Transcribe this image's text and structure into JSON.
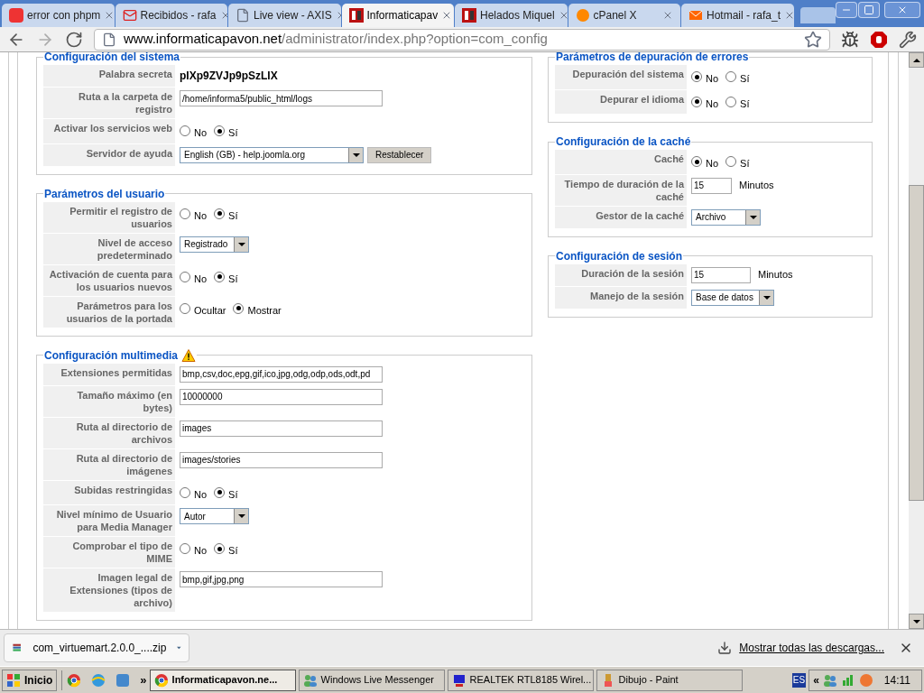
{
  "tabs": [
    {
      "label": "error con phpm",
      "selected": false
    },
    {
      "label": "Recibidos - rafa",
      "selected": false
    },
    {
      "label": "Live view - AXIS",
      "selected": false
    },
    {
      "label": "Informaticapav",
      "selected": true
    },
    {
      "label": "Helados Miquel",
      "selected": false
    },
    {
      "label": "cPanel X",
      "selected": false
    },
    {
      "label": "Hotmail - rafa_t",
      "selected": false
    }
  ],
  "address": {
    "host": "www.informaticapavon.net",
    "path": "/administrator/index.php?option=com_config"
  },
  "left_sections": [
    {
      "title": "Configuración del sistema",
      "warning": false,
      "rows": [
        {
          "label": "Palabra secreta",
          "kind": "text",
          "value": "pIXp9ZVJp9pSzLIX"
        },
        {
          "label": "Ruta a la carpeta de registro",
          "kind": "input",
          "value": "/home/informa5/public_html/logs"
        },
        {
          "label": "Activar los servicios web",
          "kind": "radio",
          "options": [
            {
              "label": "No",
              "selected": false
            },
            {
              "label": "Sí",
              "selected": true
            }
          ]
        },
        {
          "label": "Servidor de ayuda",
          "kind": "select",
          "value": "English (GB) - help.joomla.org",
          "button": "Restablecer"
        }
      ]
    },
    {
      "title": "Parámetros del usuario",
      "warning": false,
      "rows": [
        {
          "label": "Permitir el registro de usuarios",
          "kind": "radio",
          "options": [
            {
              "label": "No",
              "selected": false
            },
            {
              "label": "Sí",
              "selected": true
            }
          ]
        },
        {
          "label": "Nivel de acceso predeterminado",
          "kind": "select",
          "value": "Registrado"
        },
        {
          "label": "Activación de cuenta para los usuarios nuevos",
          "kind": "radio",
          "options": [
            {
              "label": "No",
              "selected": false
            },
            {
              "label": "Sí",
              "selected": true
            }
          ]
        },
        {
          "label": "Parámetros para los usuarios de la portada",
          "kind": "radio",
          "options": [
            {
              "label": "Ocultar",
              "selected": false
            },
            {
              "label": "Mostrar",
              "selected": true
            }
          ]
        }
      ]
    },
    {
      "title": "Configuración multimedia",
      "warning": true,
      "rows": [
        {
          "label": "Extensiones permitidas",
          "kind": "input",
          "value": "bmp,csv,doc,epg,gif,ico,jpg,odg,odp,ods,odt,pd"
        },
        {
          "label": "Tamaño máximo (en bytes)",
          "kind": "input",
          "value": "10000000"
        },
        {
          "label": "Ruta al directorio de archivos",
          "kind": "input",
          "value": "images"
        },
        {
          "label": "Ruta al directorio de imágenes",
          "kind": "input",
          "value": "images/stories"
        },
        {
          "label": "Subidas restringidas",
          "kind": "radio",
          "options": [
            {
              "label": "No",
              "selected": false
            },
            {
              "label": "Sí",
              "selected": true
            }
          ]
        },
        {
          "label": "Nivel mínimo de Usuario para Media Manager",
          "kind": "select",
          "value": "Autor"
        },
        {
          "label": "Comprobar el tipo de MIME",
          "kind": "radio",
          "options": [
            {
              "label": "No",
              "selected": false
            },
            {
              "label": "Sí",
              "selected": true
            }
          ]
        },
        {
          "label": "Imagen legal de Extensiones (tipos de archivo)",
          "kind": "input",
          "value": "bmp,gif,jpg,png"
        }
      ]
    }
  ],
  "right_sections": [
    {
      "title": "Parámetros de depuración de errores",
      "warning": false,
      "rows": [
        {
          "label": "Depuración del sistema",
          "kind": "radio",
          "options": [
            {
              "label": "No",
              "selected": true
            },
            {
              "label": "Sí",
              "selected": false
            }
          ]
        },
        {
          "label": "Depurar el idioma",
          "kind": "radio",
          "options": [
            {
              "label": "No",
              "selected": true
            },
            {
              "label": "Sí",
              "selected": false
            }
          ]
        }
      ]
    },
    {
      "title": "Configuración de la caché",
      "warning": false,
      "rows": [
        {
          "label": "Caché",
          "kind": "radio",
          "options": [
            {
              "label": "No",
              "selected": true
            },
            {
              "label": "Sí",
              "selected": false
            }
          ]
        },
        {
          "label": "Tiempo de duración de la caché",
          "kind": "short",
          "value": "15",
          "unit": "Minutos"
        },
        {
          "label": "Gestor de la caché",
          "kind": "select",
          "value": "Archivo"
        }
      ]
    },
    {
      "title": "Configuración de sesión",
      "warning": false,
      "rows": [
        {
          "label": "Duración de la sesión",
          "kind": "short",
          "value": "15",
          "unit": "Minutos"
        },
        {
          "label": "Manejo de la sesión",
          "kind": "select",
          "value": "Base de datos"
        }
      ]
    }
  ],
  "download": {
    "file": "com_virtuemart.2.0.0_....zip",
    "show_all": "Mostrar todas las descargas..."
  },
  "taskbar": {
    "start": "Inicio",
    "more": "»",
    "tasks": [
      {
        "label": "Informaticapavon.ne...",
        "selected": true
      },
      {
        "label": "Windows Live Messenger",
        "selected": false
      },
      {
        "label": "REALTEK RTL8185 Wirel...",
        "selected": false
      },
      {
        "label": "Dibujo - Paint",
        "selected": false
      }
    ],
    "language": "ES",
    "expand": "«",
    "clock": "14:11"
  }
}
